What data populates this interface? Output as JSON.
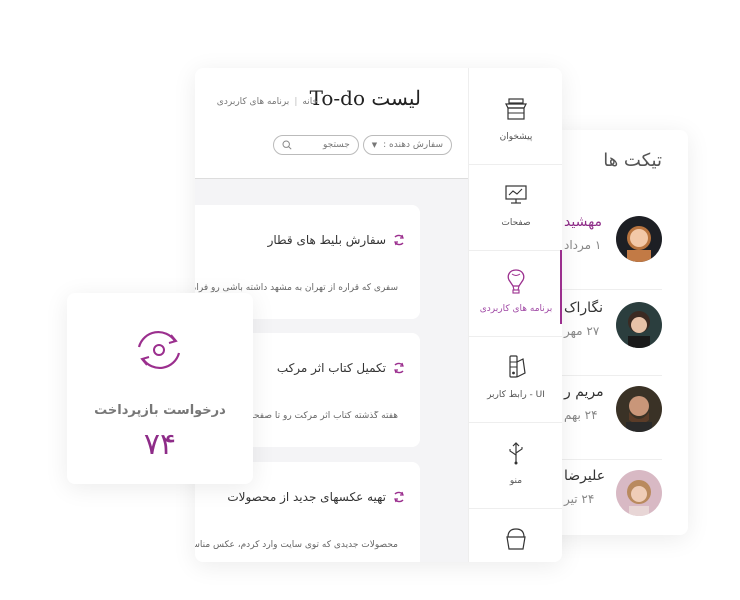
{
  "tickets": {
    "title": "تیکت ها",
    "items": [
      {
        "name": "مهشید",
        "date": "۱ مرداد",
        "name_color": "#8e2c88"
      },
      {
        "name": "نگاراک",
        "date": "۲۷ مهر"
      },
      {
        "name": "مریم ر",
        "date": "۲۴ بهم"
      },
      {
        "name": "علیرضا",
        "date": "۲۴ تیر"
      }
    ]
  },
  "todo": {
    "title": "لیست To-do",
    "breadcrumb": [
      "خانه",
      "برنامه های کاربردی"
    ],
    "sort_label": "سفارش دهنده :",
    "search_placeholder": "جستجو",
    "tasks": [
      {
        "title": "سفارش بلیط های قطار",
        "body": "سفری که قراره از تهران به مشهد داشته باشی رو فراموش نکن"
      },
      {
        "title": "تکمیل کتاب اثر مرکب",
        "body": "هفته گذشته کتاب اثر مرکت رو تا صفحه"
      },
      {
        "title": "تهیه عکسهای جدید از محصولات",
        "body": "محصولات جدیدی که توی سایت وارد کردم، عکس مناسب"
      }
    ]
  },
  "nav": {
    "items": [
      {
        "label": "پیشخوان",
        "icon": "shop-icon"
      },
      {
        "label": "صفحات",
        "icon": "monitor-chart-icon"
      },
      {
        "label": "برنامه های کاربردی",
        "icon": "balloon-icon",
        "active": true
      },
      {
        "label": "رابط کاربر - UI",
        "icon": "color-swatch-icon"
      },
      {
        "label": "منو",
        "icon": "usb-icon"
      },
      {
        "label": "",
        "icon": "bucket-icon"
      }
    ]
  },
  "refund": {
    "label": "درخواست بازپرداخت",
    "value": "۷۴",
    "icon": "refresh-icon"
  },
  "colors": {
    "accent": "#8e2c88",
    "accent_bar": "#9b2f8e",
    "panel_bg": "#f4f4f6"
  }
}
